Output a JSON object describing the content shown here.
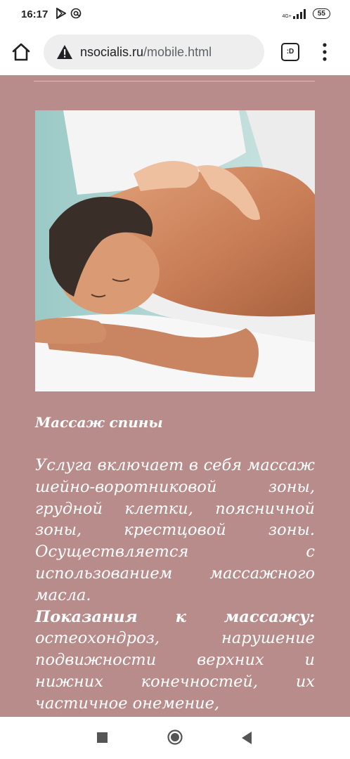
{
  "status_bar": {
    "time": "16:17",
    "network": "4G+",
    "battery": "55",
    "icons": [
      "play-store-icon",
      "at-sign-icon",
      "signal-icon"
    ]
  },
  "browser": {
    "url_domain": "nsocialis.ru",
    "url_path": "/mobile.html",
    "tab_count": ":D",
    "icons": [
      "home-icon",
      "warning-icon",
      "tab-switcher-icon",
      "overflow-menu-icon"
    ]
  },
  "article": {
    "image_icon": "massage-photo",
    "title": "Массаж спины",
    "description": "Услуга включает в себя массаж шейно-воротниковой зоны, грудной клетки, поясничной зоны, крестцовой зоны. Осуществляется с использованием массажного масла.",
    "indications_label": "Показания к массажу:",
    "indications_text": "остеохондроз, нарушение подвижности верхних и нижних конечностей, их частичное онемение,"
  },
  "navigation": {
    "icons": [
      "recents-icon",
      "home-circle-icon",
      "back-icon"
    ]
  },
  "colors": {
    "content_background": "#b98c8c",
    "text": "#ffffff",
    "chrome_background": "#ffffff"
  }
}
